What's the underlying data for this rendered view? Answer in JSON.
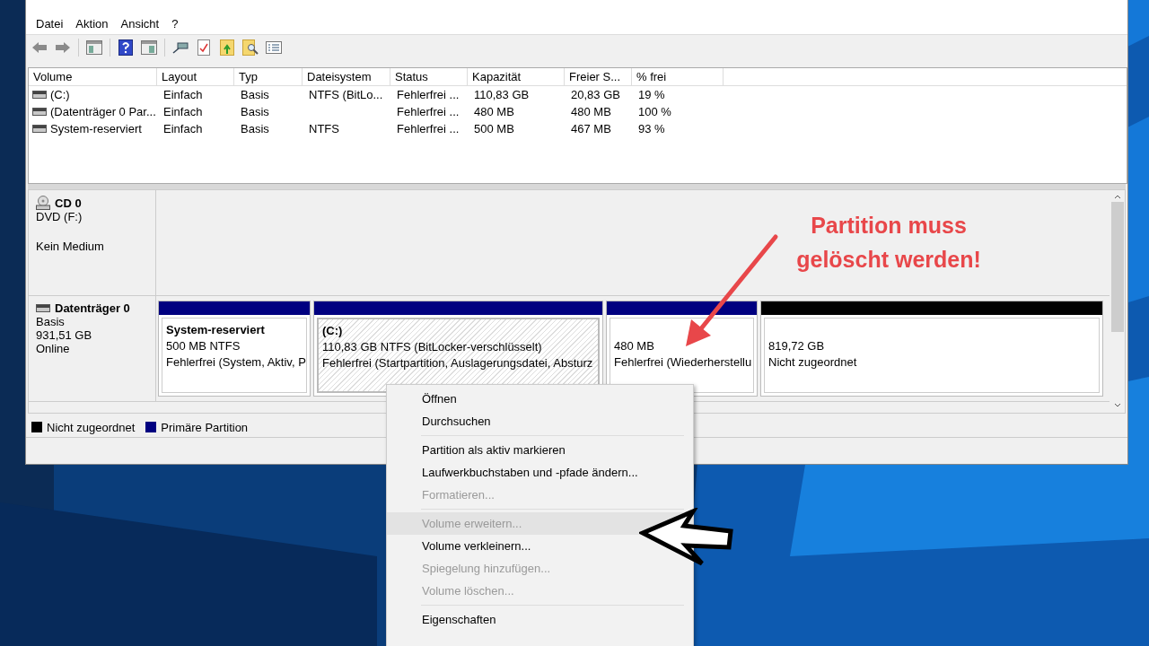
{
  "menu_bar": [
    {
      "label": "Datei"
    },
    {
      "label": "Aktion"
    },
    {
      "label": "Ansicht"
    },
    {
      "label": "?"
    }
  ],
  "volume_table": {
    "columns": [
      "Volume",
      "Layout",
      "Typ",
      "Dateisystem",
      "Status",
      "Kapazität",
      "Freier S...",
      "% frei"
    ],
    "rows": [
      [
        "(C:)",
        "Einfach",
        "Basis",
        "NTFS (BitLo...",
        "Fehlerfrei ...",
        "110,83 GB",
        "20,83 GB",
        "19 %"
      ],
      [
        "(Datenträger 0 Par...",
        "Einfach",
        "Basis",
        "",
        "Fehlerfrei ...",
        "480 MB",
        "480 MB",
        "100 %"
      ],
      [
        "System-reserviert",
        "Einfach",
        "Basis",
        "NTFS",
        "Fehlerfrei ...",
        "500 MB",
        "467 MB",
        "93 %"
      ]
    ]
  },
  "disks": [
    {
      "kind": "cd",
      "name": "CD 0",
      "lines": [
        "DVD (F:)"
      ],
      "status": "Kein Medium"
    },
    {
      "kind": "disk",
      "name": "Datenträger 0",
      "lines": [
        "Basis",
        "931,51 GB",
        "Online"
      ],
      "partitions": [
        {
          "title": "System-reserviert",
          "lines": [
            "500 MB NTFS",
            "Fehlerfrei (System, Aktiv, P"
          ],
          "color": "#000080",
          "selected": false
        },
        {
          "title": "(C:)",
          "lines": [
            "110,83 GB NTFS (BitLocker-verschlüsselt)",
            "Fehlerfrei (Startpartition, Auslagerungsdatei, Absturz"
          ],
          "color": "#000080",
          "selected": true
        },
        {
          "lines": [
            "480 MB",
            "Fehlerfrei (Wiederherstellu"
          ],
          "color": "#000080",
          "selected": false
        },
        {
          "lines": [
            "819,72 GB",
            "Nicht zugeordnet"
          ],
          "color": "#000000",
          "selected": false
        }
      ]
    }
  ],
  "legend": [
    {
      "label": "Nicht zugeordnet",
      "color": "#000000"
    },
    {
      "label": "Primäre Partition",
      "color": "#000080"
    }
  ],
  "annotation": {
    "lines": [
      "Partition muss",
      "gelöscht werden!"
    ]
  },
  "context_menu": [
    [
      {
        "label": "Öffnen",
        "disabled": false,
        "selected": false
      },
      {
        "label": "Durchsuchen",
        "disabled": false,
        "selected": false
      }
    ],
    [
      {
        "label": "Partition als aktiv markieren",
        "disabled": false,
        "selected": false
      },
      {
        "label": "Laufwerkbuchstaben und -pfade ändern...",
        "disabled": false,
        "selected": false
      },
      {
        "label": "Formatieren...",
        "disabled": true,
        "selected": false
      }
    ],
    [
      {
        "label": "Volume erweitern...",
        "disabled": true,
        "selected": true
      },
      {
        "label": "Volume verkleinern...",
        "disabled": false,
        "selected": false
      },
      {
        "label": "Spiegelung hinzufügen...",
        "disabled": true,
        "selected": false
      },
      {
        "label": "Volume löschen...",
        "disabled": true,
        "selected": false
      }
    ],
    [
      {
        "label": "Eigenschaften",
        "disabled": false,
        "selected": false
      }
    ]
  ]
}
